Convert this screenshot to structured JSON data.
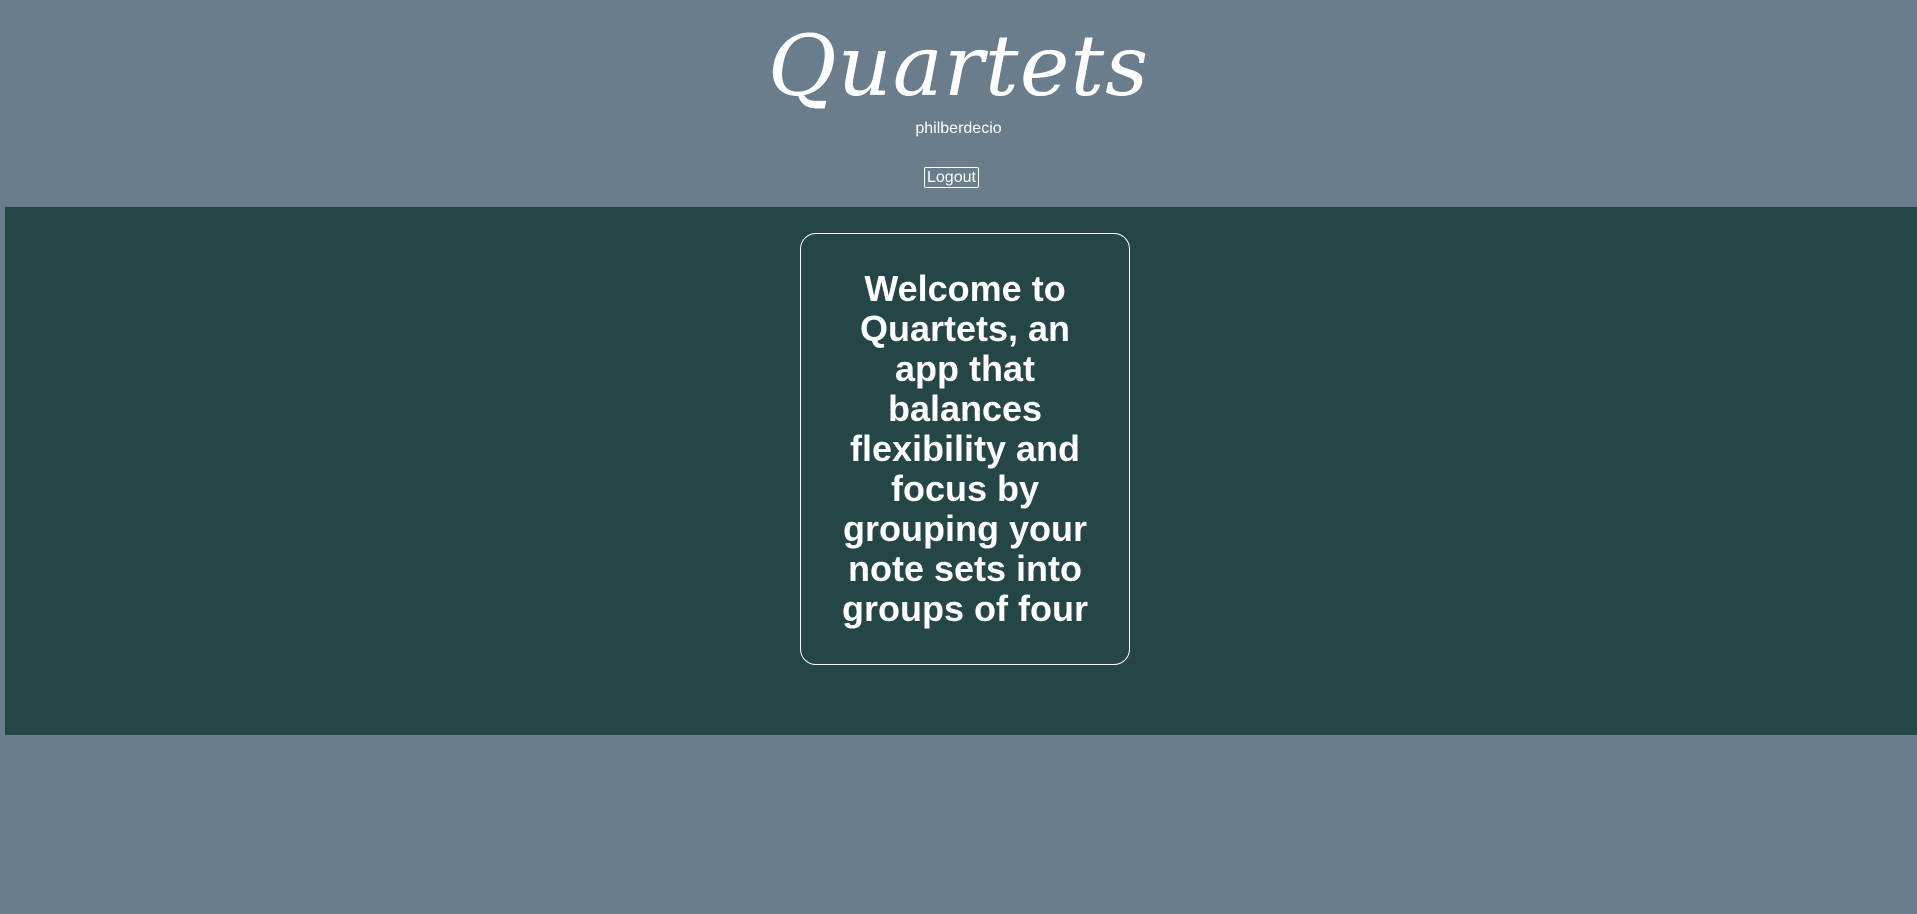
{
  "header": {
    "brand": "Quartets",
    "username": "philberdecio",
    "logout_label": "Logout"
  },
  "main": {
    "welcome_text": "Welcome to Quartets, an app that balances flexibility and focus by grouping your note sets into groups of four"
  },
  "colors": {
    "page_background": "#6a7d8c",
    "main_background": "#254647",
    "text": "#ffffff"
  }
}
